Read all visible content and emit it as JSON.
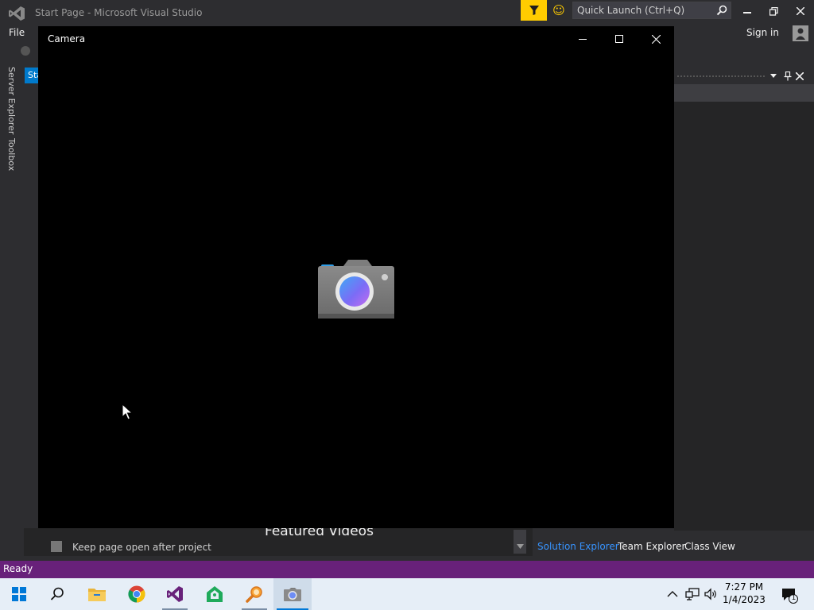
{
  "vs": {
    "title": "Start Page - Microsoft Visual Studio",
    "quick_launch_placeholder": "Quick Launch (Ctrl+Q)",
    "menu_file": "File",
    "sign_in": "Sign in",
    "rail_tabs": [
      "Server Explorer",
      "Toolbox"
    ],
    "start_tab_fragment": "Sta",
    "featured_videos": "Featured Videos",
    "keep_page_label": "Keep page open after project",
    "bottom_tabs": [
      "Solution Explorer",
      "Team Explorer",
      "Class View"
    ],
    "status": "Ready",
    "colors": {
      "accent": "#007acc",
      "status_bar": "#68217a",
      "feedback": "#ffcc00",
      "active_tab": "#3794ff"
    }
  },
  "camera": {
    "title": "Camera",
    "icons": [
      "minimize-icon",
      "maximize-icon",
      "close-icon",
      "camera-logo-icon"
    ]
  },
  "taskbar": {
    "apps": [
      "start-icon",
      "search-icon",
      "file-explorer-icon",
      "chrome-icon",
      "visual-studio-icon",
      "git-icon",
      "search-tool-icon",
      "camera-app-icon"
    ],
    "time": "7:27 PM",
    "date": "1/4/2023",
    "notification_count": "1"
  }
}
